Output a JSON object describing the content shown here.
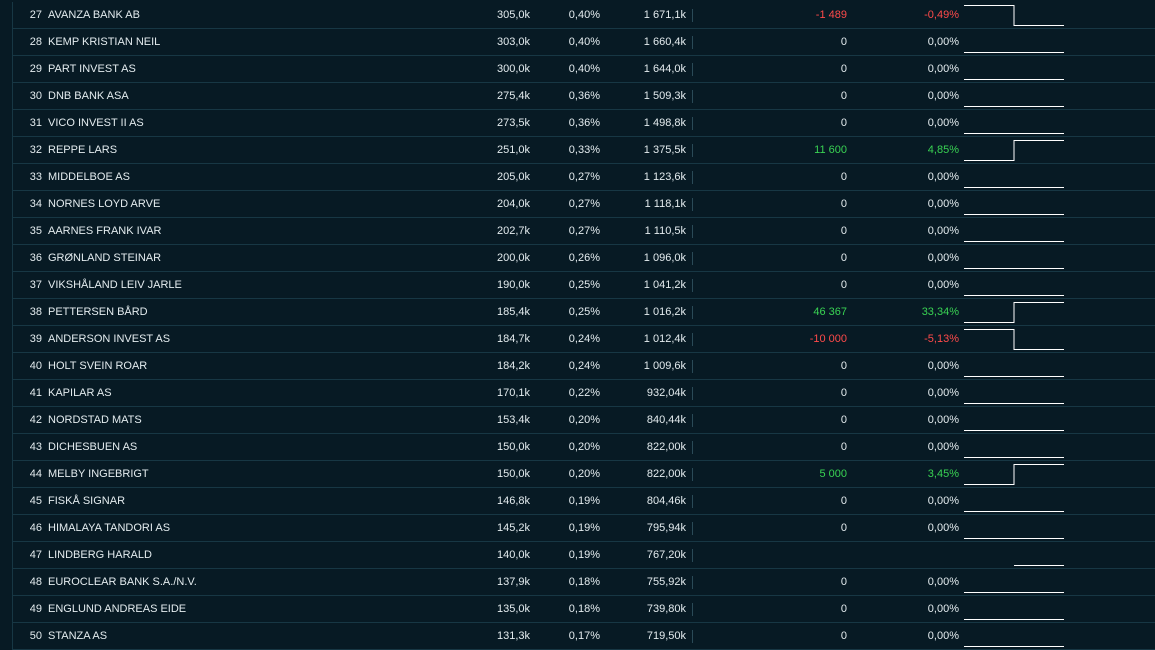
{
  "colors": {
    "background": "#071a24",
    "positive": "#39d353",
    "negative": "#ff4a4a",
    "text": "#e4ecef"
  },
  "rows": [
    {
      "rank": "27",
      "name": "AVANZA BANK AB",
      "shares": "305,0k",
      "pct": "0,40%",
      "value": "1 671,1k",
      "change": "-1 489",
      "change_pct": "-0,49%",
      "trend": "down"
    },
    {
      "rank": "28",
      "name": "KEMP KRISTIAN NEIL",
      "shares": "303,0k",
      "pct": "0,40%",
      "value": "1 660,4k",
      "change": "0",
      "change_pct": "0,00%",
      "trend": "flat"
    },
    {
      "rank": "29",
      "name": "PART INVEST AS",
      "shares": "300,0k",
      "pct": "0,40%",
      "value": "1 644,0k",
      "change": "0",
      "change_pct": "0,00%",
      "trend": "flat"
    },
    {
      "rank": "30",
      "name": "DNB BANK ASA",
      "shares": "275,4k",
      "pct": "0,36%",
      "value": "1 509,3k",
      "change": "0",
      "change_pct": "0,00%",
      "trend": "flat"
    },
    {
      "rank": "31",
      "name": "VICO INVEST II AS",
      "shares": "273,5k",
      "pct": "0,36%",
      "value": "1 498,8k",
      "change": "0",
      "change_pct": "0,00%",
      "trend": "flat"
    },
    {
      "rank": "32",
      "name": "REPPE LARS",
      "shares": "251,0k",
      "pct": "0,33%",
      "value": "1 375,5k",
      "change": "11 600",
      "change_pct": "4,85%",
      "trend": "up"
    },
    {
      "rank": "33",
      "name": "MIDDELBOE AS",
      "shares": "205,0k",
      "pct": "0,27%",
      "value": "1 123,6k",
      "change": "0",
      "change_pct": "0,00%",
      "trend": "flat"
    },
    {
      "rank": "34",
      "name": "NORNES LOYD ARVE",
      "shares": "204,0k",
      "pct": "0,27%",
      "value": "1 118,1k",
      "change": "0",
      "change_pct": "0,00%",
      "trend": "flat"
    },
    {
      "rank": "35",
      "name": "AARNES FRANK IVAR",
      "shares": "202,7k",
      "pct": "0,27%",
      "value": "1 110,5k",
      "change": "0",
      "change_pct": "0,00%",
      "trend": "flat"
    },
    {
      "rank": "36",
      "name": "GRØNLAND STEINAR",
      "shares": "200,0k",
      "pct": "0,26%",
      "value": "1 096,0k",
      "change": "0",
      "change_pct": "0,00%",
      "trend": "flat"
    },
    {
      "rank": "37",
      "name": "VIKSHÅLAND LEIV JARLE",
      "shares": "190,0k",
      "pct": "0,25%",
      "value": "1 041,2k",
      "change": "0",
      "change_pct": "0,00%",
      "trend": "flat"
    },
    {
      "rank": "38",
      "name": "PETTERSEN BÅRD",
      "shares": "185,4k",
      "pct": "0,25%",
      "value": "1 016,2k",
      "change": "46 367",
      "change_pct": "33,34%",
      "trend": "up"
    },
    {
      "rank": "39",
      "name": "ANDERSON INVEST AS",
      "shares": "184,7k",
      "pct": "0,24%",
      "value": "1 012,4k",
      "change": "-10 000",
      "change_pct": "-5,13%",
      "trend": "down"
    },
    {
      "rank": "40",
      "name": "HOLT SVEIN ROAR",
      "shares": "184,2k",
      "pct": "0,24%",
      "value": "1 009,6k",
      "change": "0",
      "change_pct": "0,00%",
      "trend": "flat"
    },
    {
      "rank": "41",
      "name": "KAPILAR AS",
      "shares": "170,1k",
      "pct": "0,22%",
      "value": "932,04k",
      "change": "0",
      "change_pct": "0,00%",
      "trend": "flat"
    },
    {
      "rank": "42",
      "name": "NORDSTAD MATS",
      "shares": "153,4k",
      "pct": "0,20%",
      "value": "840,44k",
      "change": "0",
      "change_pct": "0,00%",
      "trend": "flat"
    },
    {
      "rank": "43",
      "name": "DICHESBUEN AS",
      "shares": "150,0k",
      "pct": "0,20%",
      "value": "822,00k",
      "change": "0",
      "change_pct": "0,00%",
      "trend": "flat"
    },
    {
      "rank": "44",
      "name": "MELBY INGEBRIGT",
      "shares": "150,0k",
      "pct": "0,20%",
      "value": "822,00k",
      "change": "5 000",
      "change_pct": "3,45%",
      "trend": "up"
    },
    {
      "rank": "45",
      "name": "FISKÅ SIGNAR",
      "shares": "146,8k",
      "pct": "0,19%",
      "value": "804,46k",
      "change": "0",
      "change_pct": "0,00%",
      "trend": "flat"
    },
    {
      "rank": "46",
      "name": "HIMALAYA TANDORI AS",
      "shares": "145,2k",
      "pct": "0,19%",
      "value": "795,94k",
      "change": "0",
      "change_pct": "0,00%",
      "trend": "flat"
    },
    {
      "rank": "47",
      "name": "LINDBERG HARALD",
      "shares": "140,0k",
      "pct": "0,19%",
      "value": "767,20k",
      "change": "",
      "change_pct": "",
      "trend": "new"
    },
    {
      "rank": "48",
      "name": "EUROCLEAR BANK S.A./N.V.",
      "shares": "137,9k",
      "pct": "0,18%",
      "value": "755,92k",
      "change": "0",
      "change_pct": "0,00%",
      "trend": "flat"
    },
    {
      "rank": "49",
      "name": "ENGLUND ANDREAS EIDE",
      "shares": "135,0k",
      "pct": "0,18%",
      "value": "739,80k",
      "change": "0",
      "change_pct": "0,00%",
      "trend": "flat"
    },
    {
      "rank": "50",
      "name": "STANZA AS",
      "shares": "131,3k",
      "pct": "0,17%",
      "value": "719,50k",
      "change": "0",
      "change_pct": "0,00%",
      "trend": "flat"
    }
  ]
}
